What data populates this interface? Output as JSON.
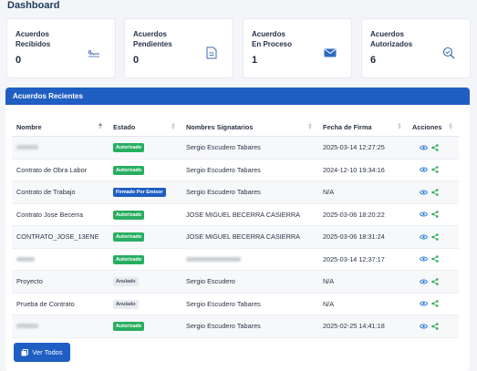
{
  "page_title": "Dashboard",
  "stats": [
    {
      "label_line1": "Acuerdos",
      "label_line2": "Recibidos",
      "value": "0",
      "icon": "signature-icon"
    },
    {
      "label_line1": "Acuerdos",
      "label_line2": "Pendientes",
      "value": "0",
      "icon": "document-icon"
    },
    {
      "label_line1": "Acuerdos",
      "label_line2": "En Proceso",
      "value": "1",
      "icon": "envelope-icon"
    },
    {
      "label_line1": "Acuerdos",
      "label_line2": "Autorizados",
      "value": "6",
      "icon": "search-check-icon"
    }
  ],
  "panel": {
    "title": "Acuerdos Recientes",
    "columns": [
      "Nombre",
      "Estado",
      "Nombres Signatarios",
      "Fecha de Firma",
      "Acciones"
    ],
    "rows": [
      {
        "nombre": "",
        "estado": "Autorizado",
        "firmantes": "Sergio Escudero Tabares",
        "fecha": "2025-03-14 12:27:25"
      },
      {
        "nombre": "Contrato de Obra Labor",
        "estado": "Autorizado",
        "firmantes": "Sergio Escudero Tabares",
        "fecha": "2024-12-10 19:34:16"
      },
      {
        "nombre": "Contrato de Trabajo",
        "estado": "Firmado Por Emisor",
        "firmantes": "Sergio Escudero Tabares",
        "fecha": "N/A"
      },
      {
        "nombre": "Contrato Jose Becerra",
        "estado": "Autorizado",
        "firmantes": "JOSE MIGUEL BECERRA CASIERRA",
        "fecha": "2025-03-06 18:20:22"
      },
      {
        "nombre": "CONTRATO_JOSE_13ENE",
        "estado": "Autorizado",
        "firmantes": "JOSE MIGUEL BECERRA CASIERRA",
        "fecha": "2025-03-06 18:31:24"
      },
      {
        "nombre": "",
        "estado": "Autorizado",
        "firmantes": "",
        "fecha": "2025-03-14 12:37:17"
      },
      {
        "nombre": "Proyecto",
        "estado": "Anulado",
        "firmantes": "Sergio Escudero",
        "fecha": "N/A"
      },
      {
        "nombre": "Prueba de Contrato",
        "estado": "Anulado",
        "firmantes": "Sergio Escudero Tabares",
        "fecha": "N/A"
      },
      {
        "nombre": "",
        "estado": "Autorizado",
        "firmantes": "Sergio Escudero Tabares",
        "fecha": "2025-02-25 14:41:18"
      }
    ],
    "button_label": "Ver Todos"
  },
  "colors": {
    "primary": "#1f5ec2",
    "autorizado": "#27ae60",
    "firmado": "#1f5ec2",
    "anulado_bg": "#e8eaee",
    "anulado_text": "#4a5568",
    "action": "#2a7bd4",
    "share": "#2eab5b"
  }
}
